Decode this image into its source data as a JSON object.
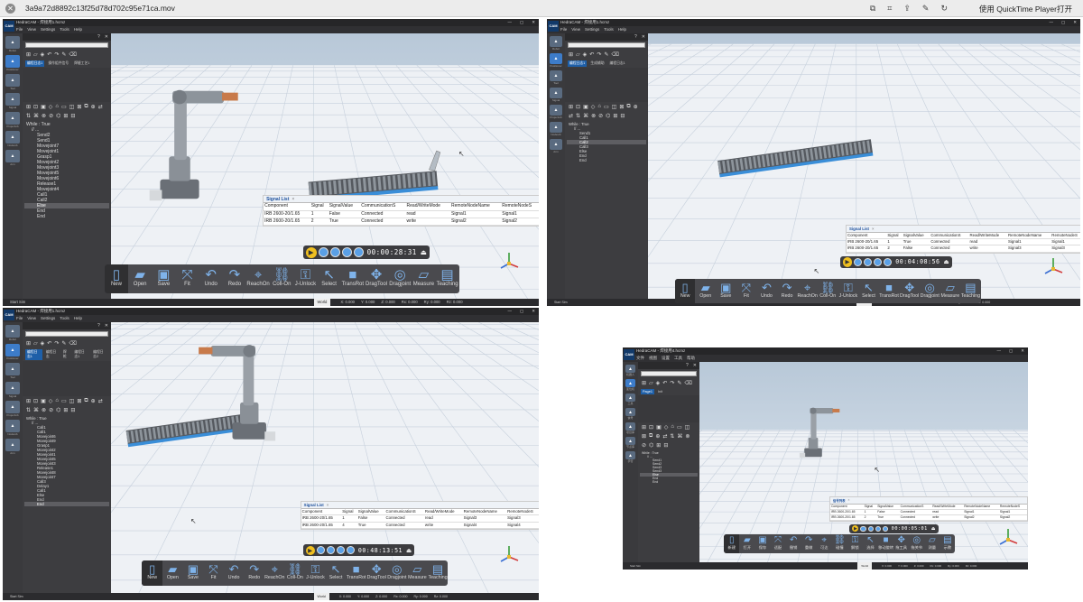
{
  "titlebar": {
    "close_icon": "x-circle-icon",
    "file_name": "3a9a72d8892c13f25d78d702c95e71ca.mov",
    "right_icons": [
      "tune-icon",
      "crop-icon",
      "share-icon",
      "edit-icon",
      "rotate-icon"
    ],
    "open_with": "使用 QuickTime Player打开"
  },
  "menus": {
    "en": [
      "File",
      "View",
      "Settings",
      "Tools",
      "Help"
    ],
    "cn": [
      "文件",
      "视图",
      "设置",
      "工具",
      "帮助"
    ]
  },
  "colors": {
    "viewport_top": "#b8c8d8",
    "viewport_bottom": "#e4ebf2",
    "floor": "#eef1f5",
    "grid": "#c6d0dc",
    "dark_ui": "#3d3d40",
    "accent_blue": "#1e5fa8",
    "play_yellow": "#f0c020"
  },
  "signal_headers": [
    "Component",
    "Signal",
    "SignalValue",
    "CommunicationS",
    "Read/WriteMode",
    "RemoteNodeName",
    "RemoteNodeS"
  ],
  "panes": [
    {
      "title": "HedraCAM - 焊接用1.hcmz",
      "menu_lang": "en",
      "logo": "CAM",
      "window_controls": [
        "—",
        "▢",
        "✕"
      ],
      "sidebar_labels": [
        "Robot",
        "Positioner",
        "Tool",
        "Signal",
        "ProjectLib",
        "NodeLib",
        "Arm"
      ],
      "panel_tabs": [
        "编程日志1",
        "操作组件信号",
        "焊缝工艺1"
      ],
      "tree": [
        "While : True",
        "// ...",
        "Send2",
        "Send1",
        "Movejoint7",
        "Movejoint1",
        "Grasp1",
        "Movejoint2",
        "Movejoint3",
        "Movejoint5",
        "Movejoint6",
        "Release1",
        "Movejoint4",
        "Call1",
        "Call2",
        "Else",
        "End",
        "End"
      ],
      "tree_selected": 15,
      "signal_title": "Signal List",
      "signal_close": "×",
      "signal_rows": [
        [
          "IRB 2600-20/1.65",
          "1",
          "False",
          "Connected",
          "read",
          "Signal1",
          "Signal1"
        ],
        [
          "IRB 2600-20/1.65",
          "2",
          "True",
          "Connected",
          "write",
          "Signal2",
          "Signal2"
        ]
      ],
      "timer_text": "00:00:28:31",
      "toolbar": [
        "New",
        "Open",
        "Save",
        "Fit",
        "Undo",
        "Redo",
        "ReachOn",
        "Coll-On",
        "J-Unlock",
        "Select",
        "TransRot",
        "DragTool",
        "Dragjoint",
        "Measure",
        "Teaching"
      ],
      "statusbar": {
        "start": "Start Sim",
        "world": "World",
        "x": "X: 0.000",
        "y": "Y: 0.000",
        "z": "Z: 0.000",
        "rx": "Rx: 0.000",
        "ry": "Ry: 0.000",
        "rz": "Rz: 0.000"
      }
    },
    {
      "title": "HedraCAM - 焊接用1.hcmz",
      "menu_lang": "en",
      "logo": "CAM",
      "window_controls": [
        "—",
        "▢",
        "✕"
      ],
      "sidebar_labels": [
        "Robot",
        "Positioner",
        "Tool",
        "Signal",
        "ProjectLib",
        "NodeLib",
        "Arm"
      ],
      "panel_tabs": [
        "编程日志1",
        "生成辅助",
        "编程日志1"
      ],
      "tree": [
        "While : True",
        "// ...",
        "Send1",
        "Call1",
        "Call2",
        "Call3",
        "Else",
        "End",
        "End"
      ],
      "tree_selected": 4,
      "signal_title": "Signal List",
      "signal_close": "×",
      "signal_rows": [
        [
          "IRB 2600-20/1.65",
          "1",
          "True",
          "Connected",
          "read",
          "Signal1",
          "Signal1"
        ],
        [
          "IRB 2600-20/1.65",
          "2",
          "False",
          "Connected",
          "write",
          "Signal3",
          "Signal3"
        ]
      ],
      "timer_text": "00:04:08:56",
      "toolbar": [
        "New",
        "Open",
        "Save",
        "Fit",
        "Undo",
        "Redo",
        "ReachOn",
        "Coll-On",
        "J-Unlock",
        "Select",
        "TransRot",
        "DragTool",
        "Dragjoint",
        "Measure",
        "Teaching"
      ],
      "statusbar": {
        "start": "Start Sim",
        "world": "World",
        "x": "X: 0.000",
        "y": "Y: 0.000",
        "z": "Z: 0.000",
        "rx": "Rx: 0.000",
        "ry": "Ry: 0.000",
        "rz": "Rz: 0.000"
      }
    },
    {
      "title": "HedraCAM - 焊接用1.hcmz",
      "menu_lang": "en",
      "logo": "CAM",
      "window_controls": [
        "—",
        "▢",
        "✕"
      ],
      "sidebar_labels": [
        "Robot",
        "Positioner",
        "Tool",
        "Signal",
        "ProjectLib",
        "NodeLib",
        "Arm"
      ],
      "panel_tabs": [
        "编程日志1",
        "编程日志",
        "焊枪",
        "编程日志1",
        "编程日志2"
      ],
      "tree": [
        "While : True",
        "// ...",
        "Call1",
        "Call1",
        "Movejoint6",
        "Movejoint9",
        "Grasp1",
        "Movejoint2",
        "Movejoint1",
        "Movejoint5",
        "Movejoint3",
        "Release1",
        "Movejoint8",
        "Movejoint7",
        "Call3",
        "Delay1",
        "Call1",
        "Else",
        "End",
        "End"
      ],
      "tree_selected": 19,
      "signal_title": "Signal List",
      "signal_close": "×",
      "signal_rows": [
        [
          "IRB 2600-20/1.65",
          "1",
          "False",
          "Connected",
          "read",
          "Signal3",
          "Signal3"
        ],
        [
          "IRB 2600-20/1.65",
          "4",
          "True",
          "Connected",
          "write",
          "Signal4",
          "Signal4"
        ]
      ],
      "timer_text": "00:48:13:51",
      "toolbar": [
        "New",
        "Open",
        "Save",
        "Fit",
        "Undo",
        "Redo",
        "ReachOn",
        "Coll-On",
        "J-Unlock",
        "Select",
        "TransRot",
        "DragTool",
        "Dragjoint",
        "Measure",
        "Teaching"
      ],
      "statusbar": {
        "start": "Start Sim",
        "world": "World",
        "x": "X: 0.000",
        "y": "Y: 0.000",
        "z": "Z: 0.000",
        "rx": "Rx: 0.000",
        "ry": "Ry: 0.000",
        "rz": "Rz: 0.000"
      }
    },
    {
      "title": "HedraCAM - 焊接用4.hcmz",
      "menu_lang": "cn",
      "logo": "CAM",
      "window_controls": [
        "—",
        "▢",
        "✕"
      ],
      "sidebar_labels": [
        "机器人",
        "变位机",
        "工具",
        "信号",
        "项目库",
        "节点库",
        "手臂"
      ],
      "panel_tabs": [
        "Page1",
        "Init"
      ],
      "tree": [
        "While : True",
        "// ...",
        "Send1",
        "Send2",
        "Send3",
        "Send3",
        "Else",
        "End",
        "End"
      ],
      "tree_selected": 6,
      "signal_title": "信号列表",
      "signal_close": "×",
      "signal_rows": [
        [
          "IRB 2600-20/1.65",
          "1",
          "False",
          "Connected",
          "read",
          "Signal1",
          "Signal1"
        ],
        [
          "IRB 2600-20/1.65",
          "2",
          "True",
          "Connected",
          "write",
          "Signal2",
          "Signal2"
        ]
      ],
      "timer_text": "00:00:05:01",
      "toolbar": [
        "新建",
        "打开",
        "保存",
        "适配",
        "撤销",
        "重做",
        "可达",
        "碰撞",
        "解锁",
        "选择",
        "移动旋转",
        "拖工具",
        "拖关节",
        "测量",
        "示教"
      ],
      "statusbar": {
        "start": "Start Sim",
        "world": "World",
        "x": "X: 0.000",
        "y": "Y: 0.000",
        "z": "Z: 0.000",
        "rx": "Rx: 0.000",
        "ry": "Ry: 0.000",
        "rz": "Rz: 0.000"
      }
    }
  ]
}
